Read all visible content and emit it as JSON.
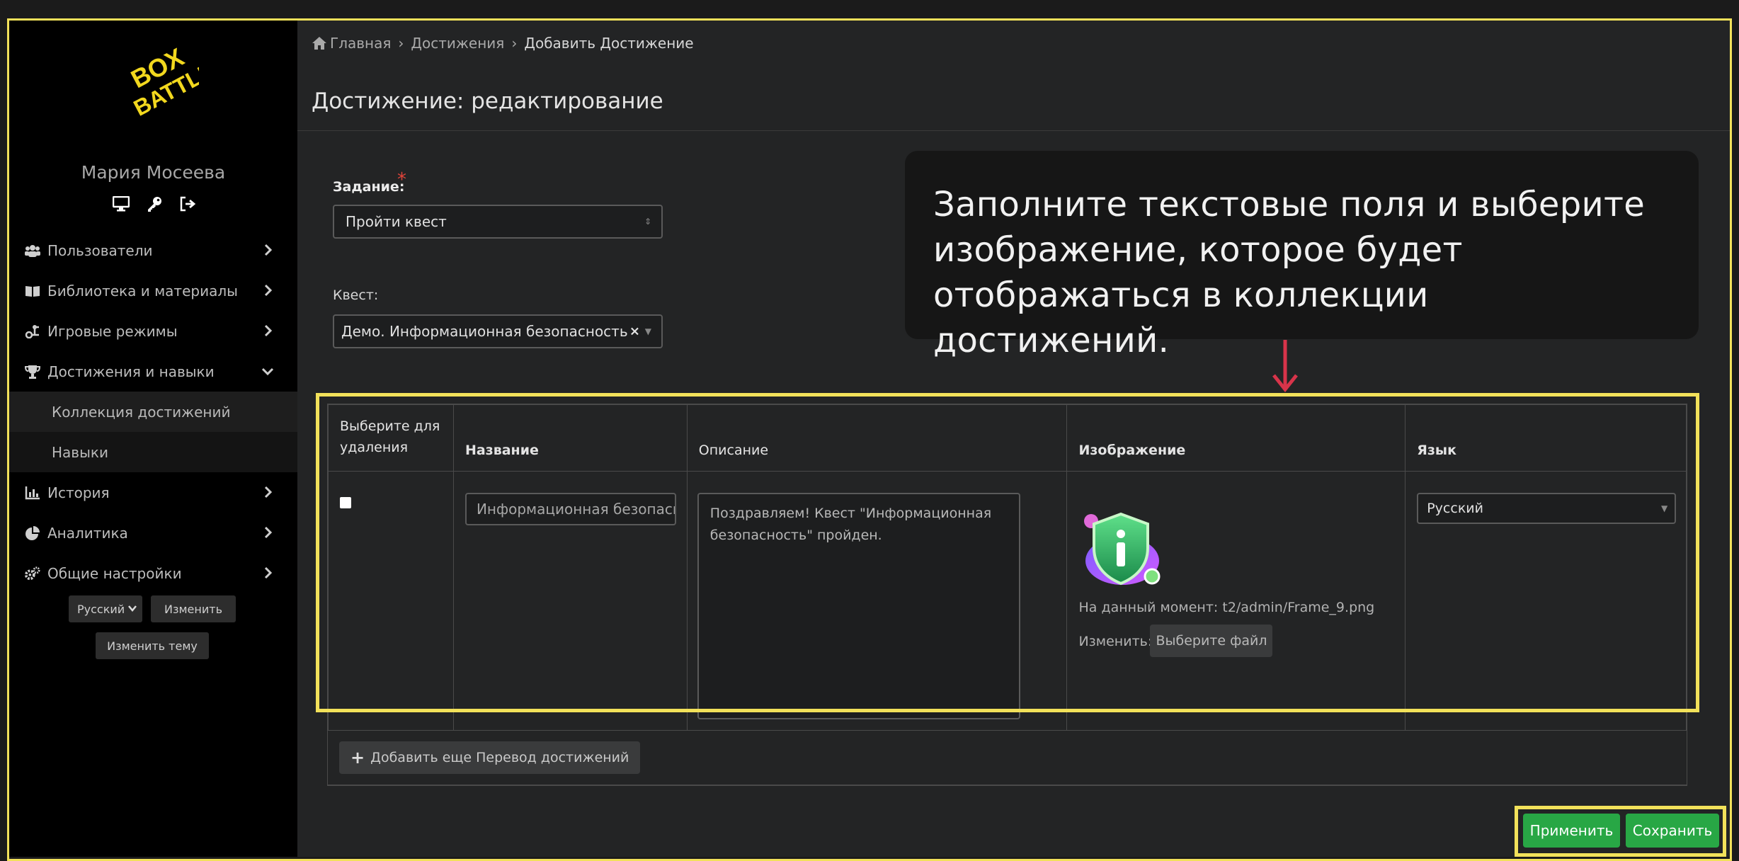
{
  "sidebar": {
    "logo_text": "BOX BATTLE",
    "user_name": "Мария Мосеева",
    "icons": [
      "monitor-icon",
      "key-icon",
      "sign-out-icon"
    ],
    "nav": [
      {
        "label": "Пользователи",
        "icon": "users-icon"
      },
      {
        "label": "Библиотека и материалы",
        "icon": "book-icon"
      },
      {
        "label": "Игровые режимы",
        "icon": "game-modes-icon"
      },
      {
        "label": "Достижения и навыки",
        "icon": "trophy-icon",
        "expanded": true
      }
    ],
    "sub_items": [
      "Коллекция достижений",
      "Навыки"
    ],
    "nav_after": [
      {
        "label": "История",
        "icon": "chart-icon"
      },
      {
        "label": "Аналитика",
        "icon": "pie-chart-icon"
      },
      {
        "label": "Общие настройки",
        "icon": "cogs-icon"
      }
    ],
    "language_select": "Русский",
    "change_button": "Изменить",
    "change_theme_button": "Изменить тему"
  },
  "breadcrumb": [
    "Главная",
    "Достижения",
    "Добавить Достижение"
  ],
  "page_title": "Достижение: редактирование",
  "form": {
    "task_label": "Задание:",
    "task_value": "Пройти квест",
    "quest_label": "Квест:",
    "quest_value": "Демо. Информационная безопасность"
  },
  "table": {
    "headers": [
      "Выберите для удаления",
      "Название",
      "Описание",
      "Изображение",
      "Язык"
    ],
    "row": {
      "name_value": "Информационная безопасн",
      "description": "Поздравляем! Квест \"Информационная безопасность\" пройден.",
      "current_image_text": "На данный момент: t2/admin/Frame_9.png",
      "change_label": "Изменить:",
      "file_button": "Выберите файл",
      "language": "Русский"
    },
    "add_button": "Добавить еще Перевод достижений"
  },
  "callout": "Заполните текстовые поля и выберите изображение, которое будет отображаться в коллекции достижений.",
  "buttons": {
    "apply": "Применить",
    "save": "Сохранить"
  },
  "colors": {
    "highlight": "#f2e15a",
    "green": "#28a745",
    "arrow": "#d8344a"
  }
}
